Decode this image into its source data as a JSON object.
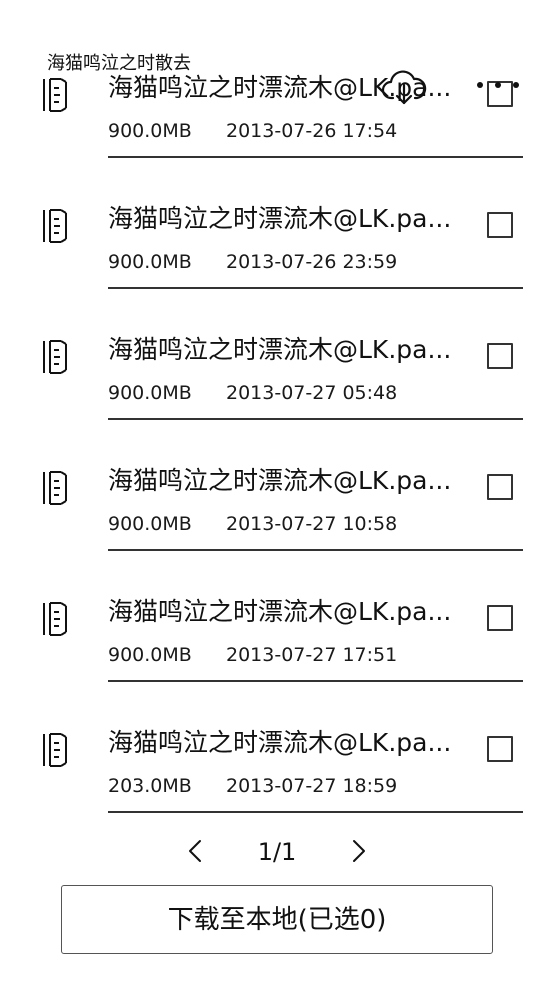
{
  "header": {
    "title": "海猫鸣泣之时散去",
    "download_icon": "cloud-download-icon",
    "more_icon": "more-dots-icon"
  },
  "files": [
    {
      "name": "海猫鸣泣之时漂流木@LK.pa...",
      "size": "900.0MB",
      "date": "2013-07-26 17:54",
      "icon": "file-icon"
    },
    {
      "name": "海猫鸣泣之时漂流木@LK.pa...",
      "size": "900.0MB",
      "date": "2013-07-26 23:59",
      "icon": "file-icon"
    },
    {
      "name": "海猫鸣泣之时漂流木@LK.pa...",
      "size": "900.0MB",
      "date": "2013-07-27 05:48",
      "icon": "file-icon"
    },
    {
      "name": "海猫鸣泣之时漂流木@LK.pa...",
      "size": "900.0MB",
      "date": "2013-07-27 10:58",
      "icon": "file-icon"
    },
    {
      "name": "海猫鸣泣之时漂流木@LK.pa...",
      "size": "900.0MB",
      "date": "2013-07-27 17:51",
      "icon": "file-icon"
    },
    {
      "name": "海猫鸣泣之时漂流木@LK.pa...",
      "size": "203.0MB",
      "date": "2013-07-27 18:59",
      "icon": "file-icon"
    }
  ],
  "pagination": {
    "page": "1/1",
    "prev_icon": "chevron-left-icon",
    "next_icon": "chevron-right-icon"
  },
  "actions": {
    "download_label": "下载至本地(已选0)"
  }
}
